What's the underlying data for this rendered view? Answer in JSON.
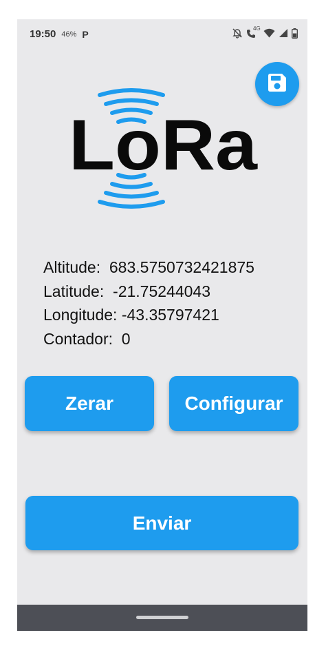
{
  "status_bar": {
    "time": "19:50",
    "battery_percent": "46%",
    "app_badge": "P",
    "network_badge": "4G",
    "icons": [
      "bell-off-icon",
      "call-4g-icon",
      "wifi-icon",
      "signal-icon",
      "battery-icon"
    ]
  },
  "save_button": {
    "icon": "floppy-disk-icon"
  },
  "logo": {
    "text": "LoRa"
  },
  "info": {
    "altitude_label": "Altitude:",
    "altitude_value": "683.5750732421875",
    "latitude_label": "Latitude:",
    "latitude_value": "-21.75244043",
    "longitude_label": "Longitude:",
    "longitude_value": "-43.35797421",
    "contador_label": "Contador:",
    "contador_value": "0"
  },
  "buttons": {
    "zerar": "Zerar",
    "configurar": "Configurar",
    "enviar": "Enviar"
  },
  "colors": {
    "accent": "#1e9cee",
    "background": "#e9e9eb",
    "nav_bar": "#4d4f56"
  }
}
